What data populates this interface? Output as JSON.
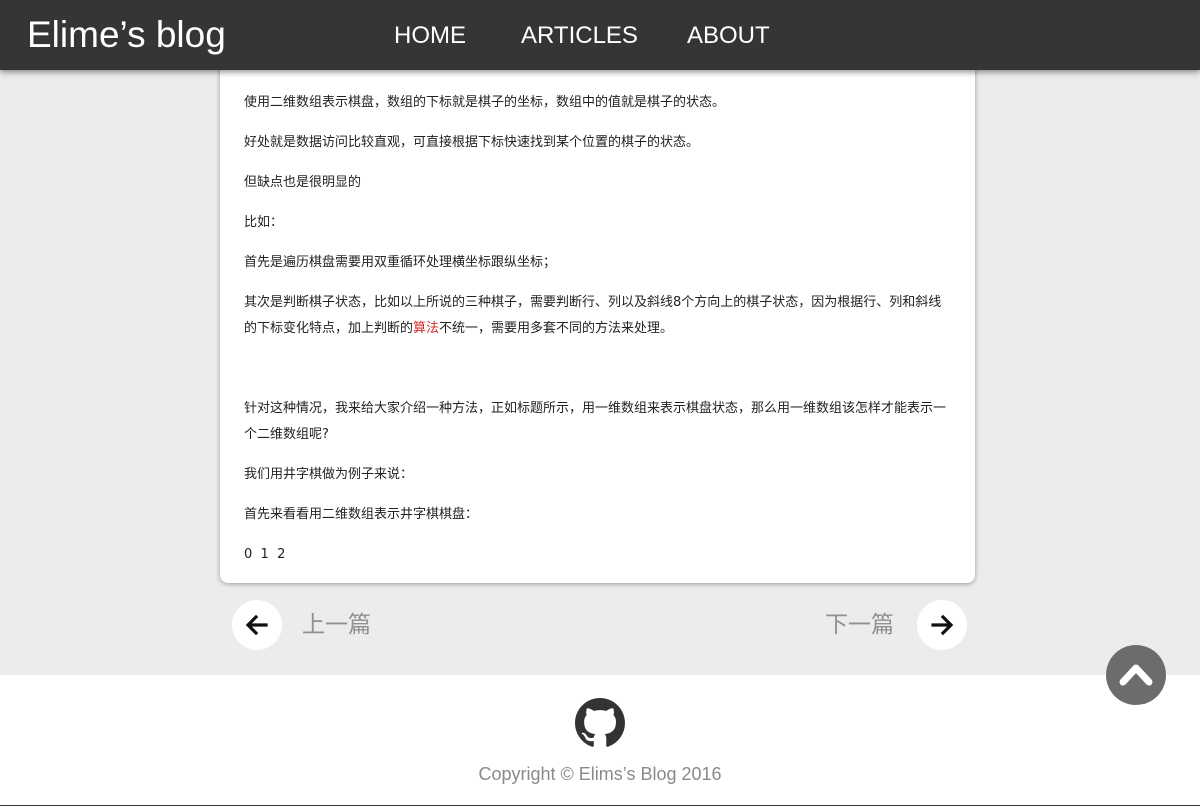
{
  "header": {
    "brand": "Elime’s blog",
    "nav": [
      {
        "label": "HOME"
      },
      {
        "label": "ARTICLES"
      },
      {
        "label": "ABOUT"
      }
    ]
  },
  "article": {
    "paragraphs": [
      "使用二维数组表示棋盘，数组的下标就是棋子的坐标，数组中的值就是棋子的状态。",
      "好处就是数据访问比较直观，可直接根据下标快速找到某个位置的棋子的状态。",
      "但缺点也是很明显的",
      "比如：",
      "首先是遍历棋盘需要用双重循环处理横坐标跟纵坐标；",
      {
        "before": "其次是判断棋子状态，比如以上所说的三种棋子，需要判断行、列以及斜线8个方向上的棋子状态，因为根据行、列和斜线的下标变化特点，加上判断的",
        "highlight": "算法",
        "after": "不统一，需要用多套不同的方法来处理。"
      },
      "针对这种情况，我来给大家介绍一种方法，正如标题所示，用一维数组来表示棋盘状态，那么用一维数组该怎样才能表示一个二维数组呢?",
      "我们用井字棋做为例子来说：",
      "首先来看看用二维数组表示井字棋棋盘：",
      "0  1  2"
    ],
    "highlight_color": "#d42a2a"
  },
  "pager": {
    "prev_label": "上一篇",
    "next_label": "下一篇",
    "prev_icon": "arrow-left-icon",
    "next_icon": "arrow-right-icon"
  },
  "back_to_top": {
    "icon": "chevron-up-icon"
  },
  "footer": {
    "icon": "github-icon",
    "copyright": "Copyright © Elims’s Blog 2016"
  },
  "colors": {
    "header_bg": "#353535",
    "page_bg": "#ececec",
    "card_bg": "#ffffff",
    "muted_text": "#909090",
    "back_to_top_bg": "#6c6c6c"
  }
}
